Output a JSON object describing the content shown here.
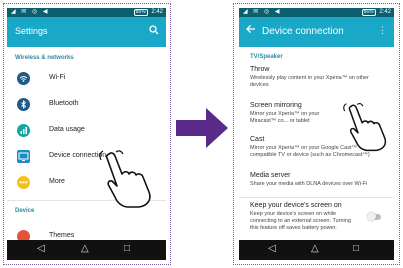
{
  "left_screen": {
    "status": {
      "icons": "◢ ✉ ◎ ◀",
      "battery": "86%",
      "time": "2:42"
    },
    "appbar": {
      "title": "Settings",
      "search_icon": "search-icon"
    },
    "section1": "Wireless & networks",
    "rows": [
      {
        "label": "Wi-Fi",
        "icon": "wifi-icon",
        "color": "#1f5a86"
      },
      {
        "label": "Bluetooth",
        "icon": "bluetooth-icon",
        "color": "#1f5a86"
      },
      {
        "label": "Data usage",
        "icon": "data-usage-icon",
        "color": "#13a6a0"
      },
      {
        "label": "Device connection",
        "icon": "device-connection-icon",
        "color": "#1a8cc9"
      },
      {
        "label": "More",
        "icon": "more-icon",
        "color": "#f3c21a"
      }
    ],
    "section2": "Device",
    "device_rows": [
      {
        "label": "Themes",
        "icon": "themes-icon",
        "color": "#e2543a"
      }
    ]
  },
  "right_screen": {
    "status": {
      "icons": "◢ ✉ ◎ ◀",
      "battery": "86%",
      "time": "2:42"
    },
    "appbar": {
      "title": "Device connection"
    },
    "section": "TV/Speaker",
    "items": [
      {
        "title": "Throw",
        "desc": "Wirelessly play content in your Xperia™ on other devices"
      },
      {
        "title": "Screen mirroring",
        "desc": "Mirror your Xperia™ on your Miracast™ co... or tablet"
      },
      {
        "title": "Cast",
        "desc": "Mirror your Xperia™ on your Google Cast™ compatible TV or device (such as Chromecast™)"
      },
      {
        "title": "Media server",
        "desc": "Share your media with DLNA devices over Wi-Fi"
      },
      {
        "title": "Keep your device's screen on",
        "desc": "Keep your device's screen on while connecting to an external screen. Turning this feature off saves battery power."
      }
    ]
  },
  "navbar": {
    "back": "◁",
    "home": "△",
    "recents": "□"
  },
  "colors": {
    "appbar": "#1aa8c9",
    "statusbar": "#0c5f6e",
    "arrow": "#5a2a8a"
  }
}
